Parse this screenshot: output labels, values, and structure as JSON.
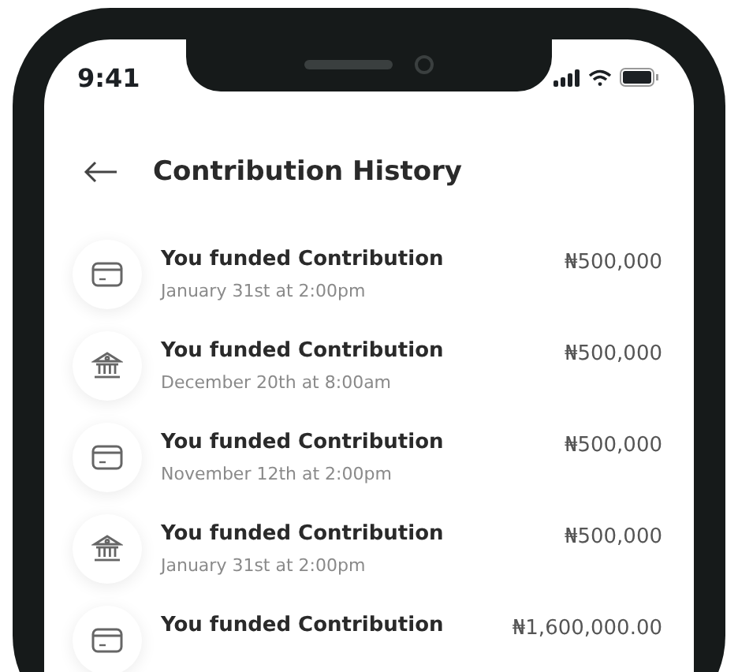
{
  "status_bar": {
    "time": "9:41"
  },
  "header": {
    "title": "Contribution History"
  },
  "transactions": [
    {
      "kind": "card",
      "title": "You funded Contribution",
      "date": "January 31st at 2:00pm",
      "amount": "₦500,000"
    },
    {
      "kind": "bank",
      "title": "You funded Contribution",
      "date": "December 20th at 8:00am",
      "amount": "₦500,000"
    },
    {
      "kind": "card",
      "title": "You funded Contribution",
      "date": "November 12th at 2:00pm",
      "amount": "₦500,000"
    },
    {
      "kind": "bank",
      "title": "You funded Contribution",
      "date": "January 31st at 2:00pm",
      "amount": "₦500,000"
    },
    {
      "kind": "card",
      "title": "You funded Contribution",
      "amount": "₦1,600,000.00"
    }
  ]
}
